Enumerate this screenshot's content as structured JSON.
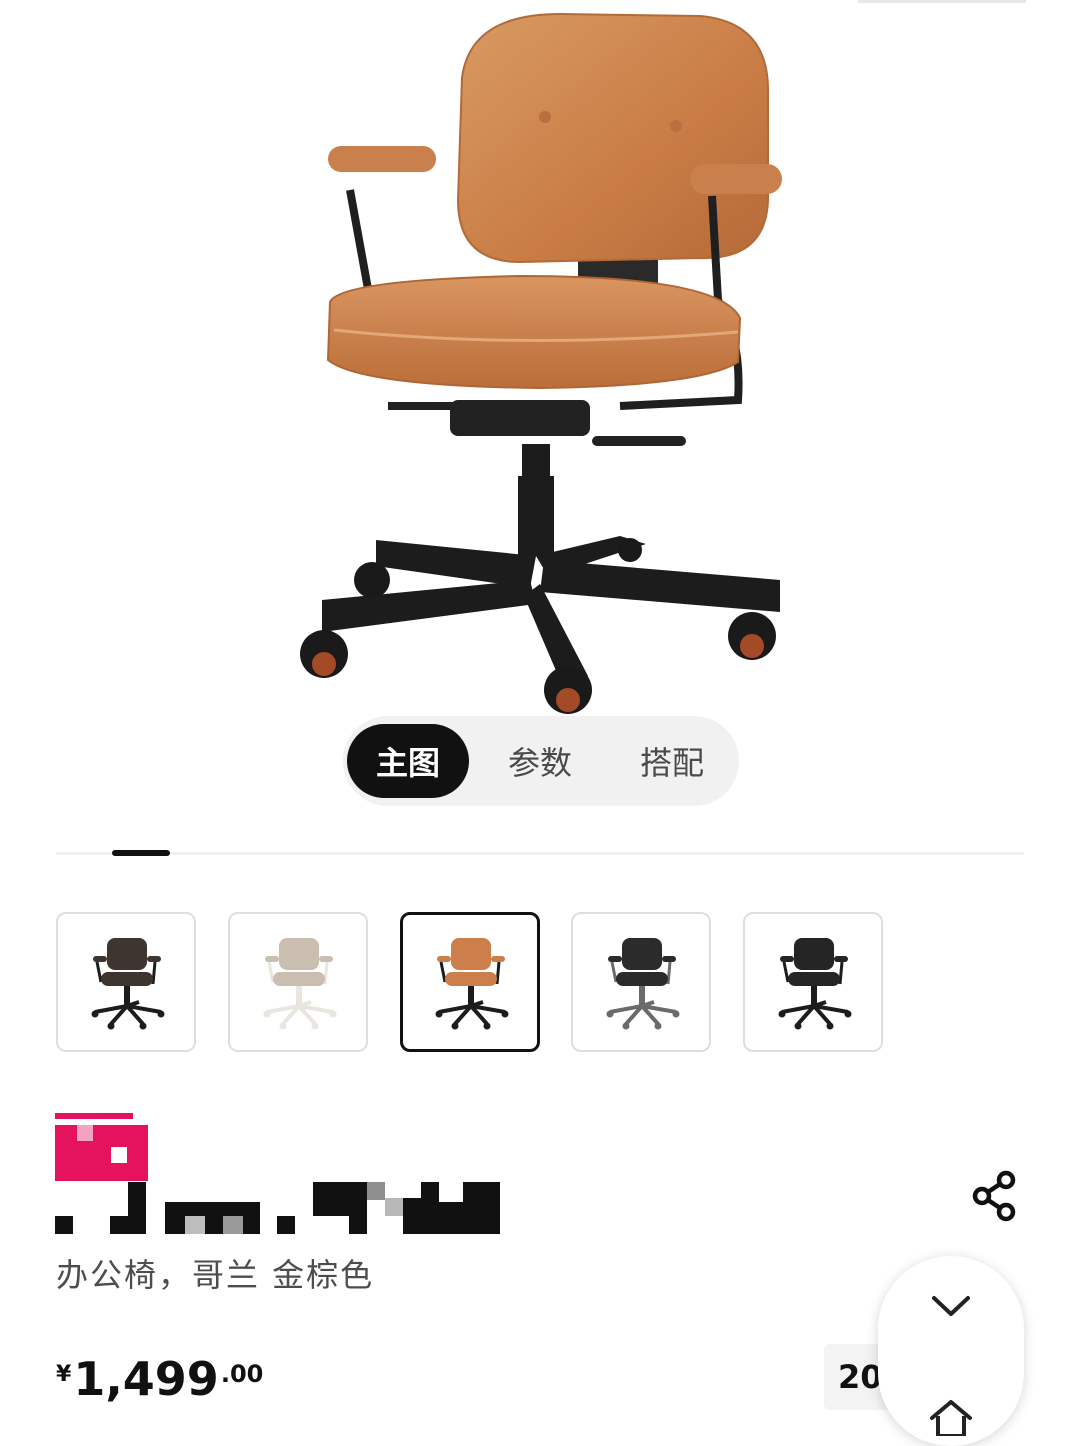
{
  "gallery": {
    "tabs": [
      {
        "label": "主图",
        "active": true
      },
      {
        "label": "参数",
        "active": false
      },
      {
        "label": "搭配",
        "active": false
      }
    ],
    "progress": 0.06
  },
  "thumbnails": [
    {
      "color_name": "dark-brown",
      "seat": "#3e3530",
      "frame": "#1c1c1c"
    },
    {
      "color_name": "beige",
      "seat": "#c9beb0",
      "frame": "#e9e6e0"
    },
    {
      "color_name": "golden-brown",
      "seat": "#cc7f4b",
      "frame": "#1c1c1c",
      "selected": true
    },
    {
      "color_name": "black-grey-base",
      "seat": "#2b2b2b",
      "frame": "#6a6a6a"
    },
    {
      "color_name": "black",
      "seat": "#252525",
      "frame": "#1c1c1c"
    }
  ],
  "product": {
    "subtitle": "办公椅，哥兰 金棕色",
    "price": {
      "currency": "¥",
      "integer": "1,499",
      "decimal": ".00"
    },
    "promo_chip": "20"
  },
  "colors": {
    "accent_pink": "#e5135e",
    "chair_leather": "#cc7f4b",
    "frame_black": "#1c1c1c"
  }
}
